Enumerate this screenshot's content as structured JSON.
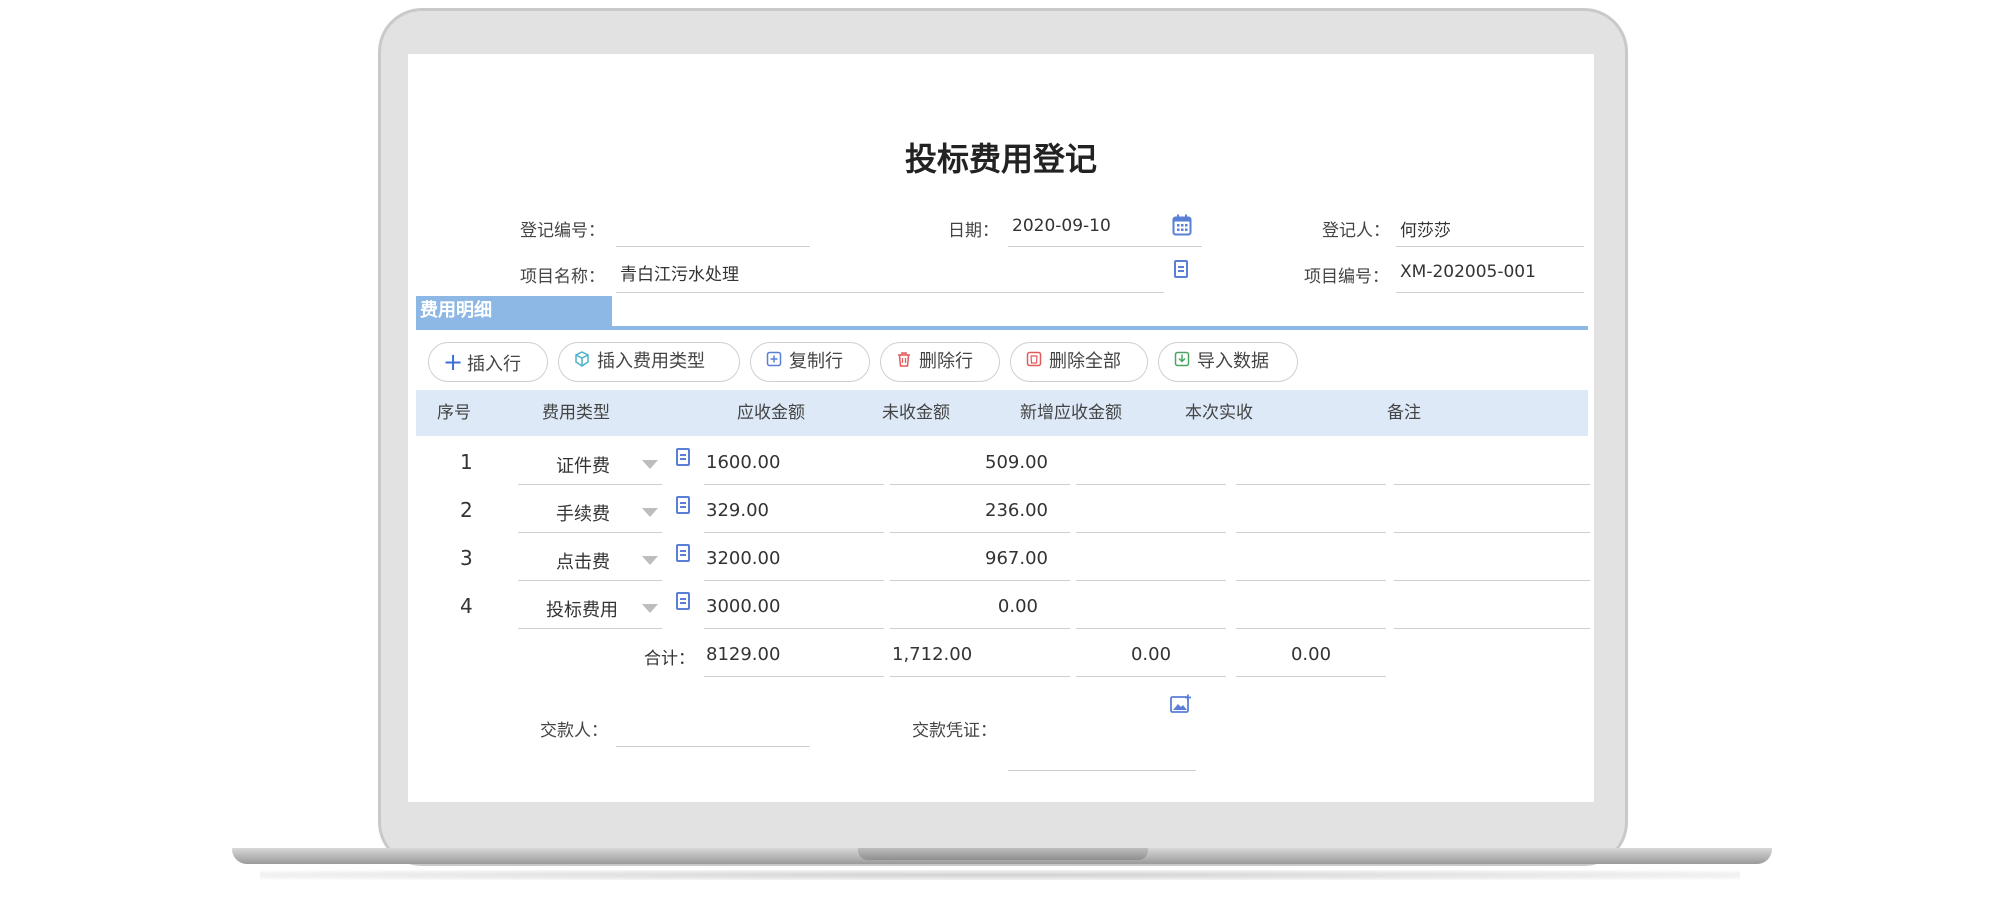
{
  "form": {
    "title": "投标费用登记",
    "reg_no_label": "登记编号：",
    "reg_no_value": "",
    "date_label": "日期：",
    "date_value": "2020-09-10",
    "registrar_label": "登记人：",
    "registrar_value": "何莎莎",
    "project_name_label": "项目名称：",
    "project_name_value": "青白江污水处理",
    "project_no_label": "项目编号：",
    "project_no_value": "XM-202005-001"
  },
  "section": {
    "title": "费用明细"
  },
  "toolbar": {
    "insert_row": "插入行",
    "insert_fee_type": "插入费用类型",
    "copy_row": "复制行",
    "delete_row": "删除行",
    "delete_all": "删除全部",
    "import_data": "导入数据"
  },
  "table": {
    "headers": [
      "序号",
      "费用类型",
      "应收金额",
      "未收金额",
      "新增应收金额",
      "本次实收",
      "备注"
    ],
    "rows": [
      {
        "no": "1",
        "type": "证件费",
        "receivable": "1600.00",
        "unreceived": "509.00",
        "new_receivable": "",
        "received": "",
        "note": ""
      },
      {
        "no": "2",
        "type": "手续费",
        "receivable": "329.00",
        "unreceived": "236.00",
        "new_receivable": "",
        "received": "",
        "note": ""
      },
      {
        "no": "3",
        "type": "点击费",
        "receivable": "3200.00",
        "unreceived": "967.00",
        "new_receivable": "",
        "received": "",
        "note": ""
      },
      {
        "no": "4",
        "type": "投标费用",
        "receivable": "3000.00",
        "unreceived": "0.00",
        "new_receivable": "",
        "received": "",
        "note": ""
      }
    ],
    "total_label": "合计：",
    "total_receivable": "8129.00",
    "total_unreceived": "1,712.00",
    "total_new_receivable": "0.00",
    "total_received": "0.00"
  },
  "payment": {
    "payer_label": "交款人：",
    "payer_value": "",
    "voucher_label": "交款凭证："
  },
  "icons": {
    "calendar": "calendar-icon",
    "lookup": "document-lookup-icon",
    "image_upload": "image-upload-icon"
  },
  "colors": {
    "accent": "#8db8e6",
    "header_bg": "#dde9f7",
    "icon_blue": "#5a7fd6"
  }
}
